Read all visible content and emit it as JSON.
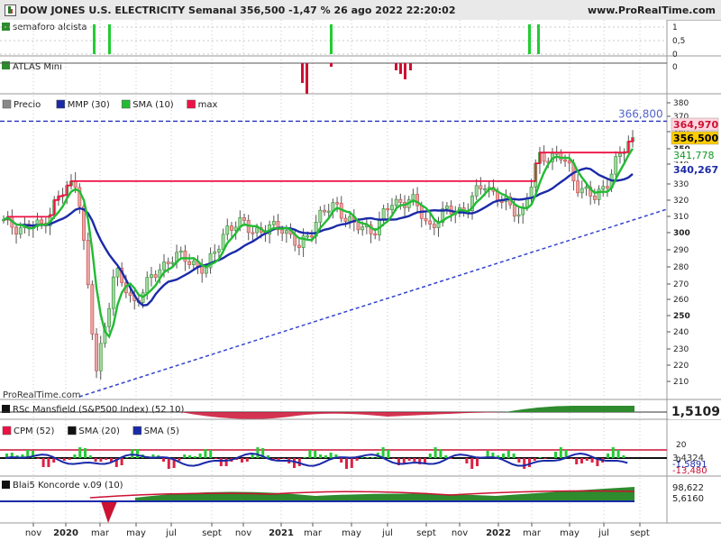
{
  "header": {
    "title": "DOW JONES U.S. ELECTRICITY Semanal 356,500 -1,47 % 26 ago 2022 22:20:02",
    "url": "www.ProRealTime.com"
  },
  "watermark": "ProRealTime.com",
  "colors": {
    "up": "#2e8b2e",
    "down": "#c84040",
    "upLight": "#9fd89f",
    "downLight": "#e8a5a5",
    "mmp": "#1a2aa8",
    "sma10": "#22bb33",
    "max": "#ee1144",
    "trend": "#3344cc",
    "grid": "#c8c8c8"
  },
  "panels": {
    "semaforo": {
      "label": "semaforo alcista",
      "ticks": [
        "1",
        "0,5",
        "0"
      ]
    },
    "atlas": {
      "label": "ATLAS Mini",
      "ticks": [
        "0"
      ]
    },
    "price": {
      "legend": [
        {
          "label": "Precio",
          "color": "#888888"
        },
        {
          "label": "MMP (30)",
          "color": "#1a2aa8"
        },
        {
          "label": "SMA (10)",
          "color": "#22bb33"
        },
        {
          "label": "max",
          "color": "#ee1144"
        }
      ],
      "ticks": [
        "380",
        "370",
        "360",
        "350",
        "340",
        "330",
        "320",
        "310",
        "300",
        "290",
        "280",
        "270",
        "260",
        "250",
        "240",
        "230",
        "220",
        "210"
      ],
      "badges": [
        {
          "text": "364,970",
          "value": 364.97,
          "fg": "#cc1133",
          "bg": "#ffd6df",
          "bold": true
        },
        {
          "text": "356,500",
          "value": 356.5,
          "fg": "#000000",
          "bg": "#ffcc00",
          "bold": true
        },
        {
          "text": "341,778",
          "value": 341.778,
          "fg": "#119922",
          "bg": "#ffffff",
          "bold": false
        },
        {
          "text": "340,267",
          "value": 340.267,
          "fg": "#1a2aa8",
          "bg": "#ffffff",
          "bold": true
        }
      ],
      "maxLabel": "366,800"
    },
    "rsc": {
      "label": "RSc Mansfield (S&P500 Index) (52 10)",
      "value": "1,5109"
    },
    "cpm": {
      "legend": [
        {
          "label": "CPM (52)",
          "color": "#ee1144"
        },
        {
          "label": "SMA (20)",
          "color": "#111111"
        },
        {
          "label": "SMA (5)",
          "color": "#1a2aa8"
        }
      ],
      "ticks": [
        "20",
        "0"
      ],
      "badges": [
        {
          "text": "3,4324",
          "fg": "#333333"
        },
        {
          "text": "-1,5891",
          "fg": "#1a2aa8"
        },
        {
          "text": "-13,480",
          "fg": "#cc1133"
        }
      ]
    },
    "blai": {
      "label": "Blai5 Koncorde v.09 (10)",
      "badges": [
        "98,622",
        "5,6160"
      ]
    }
  },
  "xaxis": {
    "labels": [
      {
        "t": "nov",
        "bold": false
      },
      {
        "t": "2020",
        "bold": true
      },
      {
        "t": "mar",
        "bold": false
      },
      {
        "t": "may",
        "bold": false
      },
      {
        "t": "jul",
        "bold": false
      },
      {
        "t": "sept",
        "bold": false
      },
      {
        "t": "nov",
        "bold": false
      },
      {
        "t": "2021",
        "bold": true
      },
      {
        "t": "mar",
        "bold": false
      },
      {
        "t": "may",
        "bold": false
      },
      {
        "t": "jul",
        "bold": false
      },
      {
        "t": "sept",
        "bold": false
      },
      {
        "t": "nov",
        "bold": false
      },
      {
        "t": "2022",
        "bold": true
      },
      {
        "t": "mar",
        "bold": false
      },
      {
        "t": "may",
        "bold": false
      },
      {
        "t": "jul",
        "bold": false
      },
      {
        "t": "sept",
        "bold": false
      }
    ]
  },
  "chart_data": {
    "type": "line",
    "title": "DOW JONES U.S. ELECTRICITY Semanal",
    "ylim": [
      204,
      384
    ],
    "last_close": 356.5,
    "max_level": 366.8,
    "close_series": [
      {
        "date": "2019-10",
        "value": 306
      },
      {
        "date": "2019-11",
        "value": 303
      },
      {
        "date": "2019-12",
        "value": 304
      },
      {
        "date": "2020-01",
        "value": 322
      },
      {
        "date": "2020-02",
        "value": 333
      },
      {
        "date": "2020-03",
        "value": 215
      },
      {
        "date": "2020-04",
        "value": 278
      },
      {
        "date": "2020-05",
        "value": 258
      },
      {
        "date": "2020-06",
        "value": 273
      },
      {
        "date": "2020-07",
        "value": 286
      },
      {
        "date": "2020-08",
        "value": 284
      },
      {
        "date": "2020-09",
        "value": 278
      },
      {
        "date": "2020-10",
        "value": 303
      },
      {
        "date": "2020-11",
        "value": 305
      },
      {
        "date": "2020-12",
        "value": 300
      },
      {
        "date": "2021-01",
        "value": 305
      },
      {
        "date": "2021-02",
        "value": 290
      },
      {
        "date": "2021-03",
        "value": 310
      },
      {
        "date": "2021-04",
        "value": 317
      },
      {
        "date": "2021-05",
        "value": 303
      },
      {
        "date": "2021-06",
        "value": 302
      },
      {
        "date": "2021-07",
        "value": 318
      },
      {
        "date": "2021-08",
        "value": 321
      },
      {
        "date": "2021-09",
        "value": 304
      },
      {
        "date": "2021-10",
        "value": 313
      },
      {
        "date": "2021-11",
        "value": 315
      },
      {
        "date": "2021-12",
        "value": 331
      },
      {
        "date": "2022-01",
        "value": 318
      },
      {
        "date": "2022-02",
        "value": 312
      },
      {
        "date": "2022-03",
        "value": 345
      },
      {
        "date": "2022-04",
        "value": 346
      },
      {
        "date": "2022-05",
        "value": 330
      },
      {
        "date": "2022-06",
        "value": 320
      },
      {
        "date": "2022-07",
        "value": 340
      },
      {
        "date": "2022-08",
        "value": 356.5
      }
    ],
    "series": [
      {
        "name": "MMP (30)",
        "last": 340.267
      },
      {
        "name": "SMA (10)",
        "last": 341.778
      },
      {
        "name": "max",
        "last": 364.97
      }
    ]
  }
}
